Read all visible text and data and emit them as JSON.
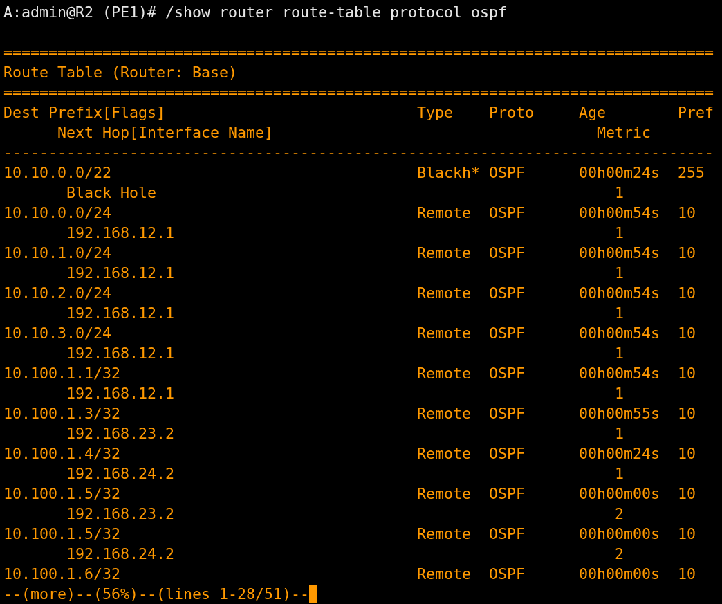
{
  "prompt": "A:admin@R2 (PE1)# /show router route-table protocol ospf",
  "separator_top": "===============================================================================",
  "title": "Route Table (Router: Base)",
  "separator_mid": "===============================================================================",
  "header": {
    "dest_prefix": "Dest Prefix[Flags]",
    "type": "Type",
    "proto": "Proto",
    "age": "Age",
    "pref": "Pref",
    "next_hop": "Next Hop[Interface Name]",
    "metric": "Metric"
  },
  "separator_dash": "-------------------------------------------------------------------------------",
  "routes": [
    {
      "prefix": "10.10.0.0/22",
      "type": "Blackh*",
      "proto": "OSPF",
      "age": "00h00m24s",
      "pref": "255",
      "next_hop": "Black Hole",
      "metric": "1"
    },
    {
      "prefix": "10.10.0.0/24",
      "type": "Remote",
      "proto": "OSPF",
      "age": "00h00m54s",
      "pref": "10",
      "next_hop": "192.168.12.1",
      "metric": "1"
    },
    {
      "prefix": "10.10.1.0/24",
      "type": "Remote",
      "proto": "OSPF",
      "age": "00h00m54s",
      "pref": "10",
      "next_hop": "192.168.12.1",
      "metric": "1"
    },
    {
      "prefix": "10.10.2.0/24",
      "type": "Remote",
      "proto": "OSPF",
      "age": "00h00m54s",
      "pref": "10",
      "next_hop": "192.168.12.1",
      "metric": "1"
    },
    {
      "prefix": "10.10.3.0/24",
      "type": "Remote",
      "proto": "OSPF",
      "age": "00h00m54s",
      "pref": "10",
      "next_hop": "192.168.12.1",
      "metric": "1"
    },
    {
      "prefix": "10.100.1.1/32",
      "type": "Remote",
      "proto": "OSPF",
      "age": "00h00m54s",
      "pref": "10",
      "next_hop": "192.168.12.1",
      "metric": "1"
    },
    {
      "prefix": "10.100.1.3/32",
      "type": "Remote",
      "proto": "OSPF",
      "age": "00h00m55s",
      "pref": "10",
      "next_hop": "192.168.23.2",
      "metric": "1"
    },
    {
      "prefix": "10.100.1.4/32",
      "type": "Remote",
      "proto": "OSPF",
      "age": "00h00m24s",
      "pref": "10",
      "next_hop": "192.168.24.2",
      "metric": "1"
    },
    {
      "prefix": "10.100.1.5/32",
      "type": "Remote",
      "proto": "OSPF",
      "age": "00h00m00s",
      "pref": "10",
      "next_hop": "192.168.23.2",
      "metric": "2"
    },
    {
      "prefix": "10.100.1.5/32",
      "type": "Remote",
      "proto": "OSPF",
      "age": "00h00m00s",
      "pref": "10",
      "next_hop": "192.168.24.2",
      "metric": "2"
    },
    {
      "prefix": "10.100.1.6/32",
      "type": "Remote",
      "proto": "OSPF",
      "age": "00h00m00s",
      "pref": "10"
    }
  ],
  "more": "--(more)--(56%)--(lines 1-28/51)--"
}
